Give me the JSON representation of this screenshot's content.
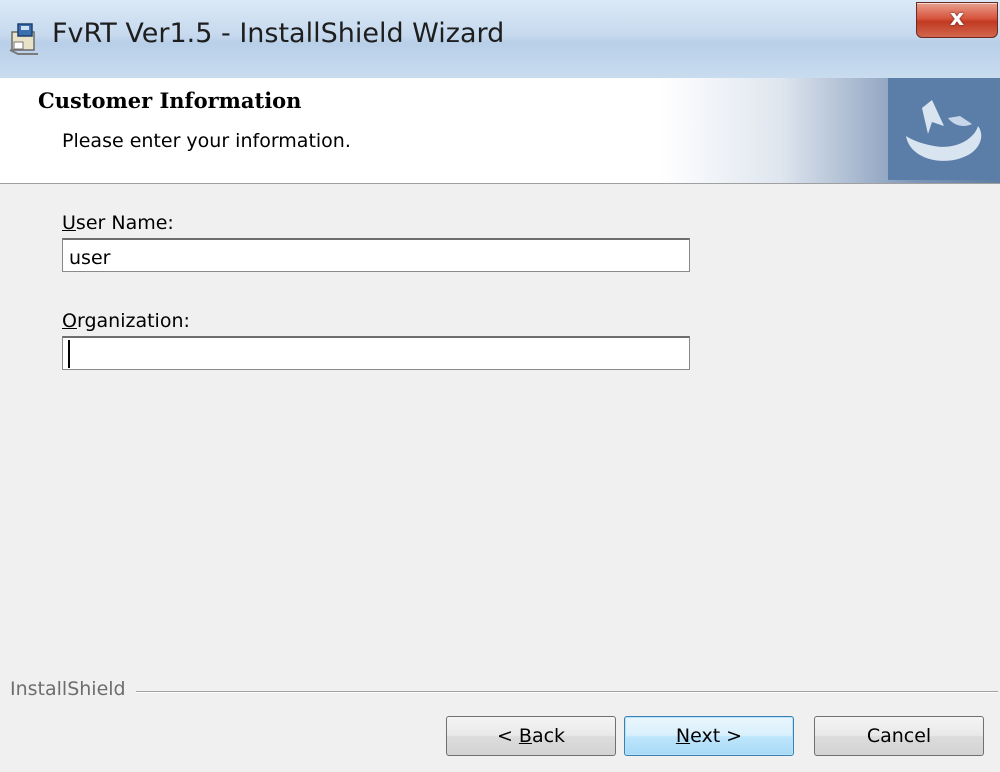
{
  "window": {
    "title": "FvRT Ver1.5 - InstallShield Wizard",
    "close_glyph": "x",
    "icon": "installer-icon"
  },
  "header": {
    "title": "Customer Information",
    "subtitle": "Please enter your information.",
    "logo_icon": "installshield-logo-icon"
  },
  "form": {
    "user_name": {
      "label_mnemonic": "U",
      "label_rest": "ser Name:",
      "value": "user"
    },
    "organization": {
      "label_mnemonic": "O",
      "label_rest": "rganization:",
      "value": ""
    }
  },
  "footer": {
    "brand": "InstallShield",
    "back_prefix": "< ",
    "back_mnemonic": "B",
    "back_rest": "ack",
    "next_mnemonic": "N",
    "next_rest": "ext >",
    "cancel_label": "Cancel"
  },
  "colors": {
    "accent": "#3c7fb1",
    "close_red": "#c23a22",
    "logo_blue": "#5b7ea8"
  }
}
